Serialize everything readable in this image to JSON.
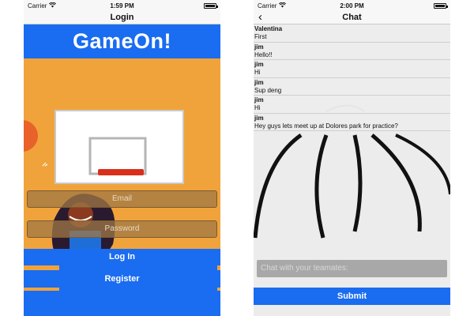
{
  "login_screen": {
    "status": {
      "carrier": "Carrier",
      "time": "1:59 PM"
    },
    "nav_title": "Login",
    "brand": "GameOn!",
    "email_placeholder": "Email",
    "password_placeholder": "Password",
    "login_label": "Log In",
    "register_label": "Register"
  },
  "chat_screen": {
    "status": {
      "carrier": "Carrier",
      "time": "2:00 PM"
    },
    "nav_title": "Chat",
    "back_icon": "chevron-left-icon",
    "messages": [
      {
        "sender": "Valentina",
        "text": "First"
      },
      {
        "sender": "jim",
        "text": "Hello!!"
      },
      {
        "sender": "jim",
        "text": "Hi"
      },
      {
        "sender": "jim",
        "text": "Sup deng"
      },
      {
        "sender": "jim",
        "text": "Hi"
      },
      {
        "sender": "jim",
        "text": "Hey guys lets meet up at Dolores park for practice?"
      }
    ],
    "input_placeholder": "Chat with your teamates:",
    "submit_label": "Submit"
  },
  "colors": {
    "accent": "#1a6cf0",
    "court_orange": "#f0a33b"
  }
}
